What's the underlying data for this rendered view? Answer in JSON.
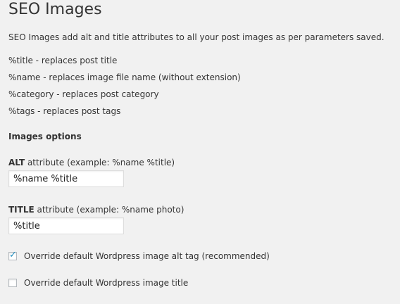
{
  "page": {
    "title": "SEO Images",
    "description": "SEO Images add alt and title attributes to all your post images as per parameters saved."
  },
  "tokens": [
    "%title - replaces post title",
    "%name - replaces image file name (without extension)",
    "%category - replaces post category",
    "%tags - replaces post tags"
  ],
  "options": {
    "heading": "Images options",
    "alt": {
      "label_strong": "ALT",
      "label_rest": " attribute (example: %name %title)",
      "value": "%name %title"
    },
    "title_attr": {
      "label_strong": "TITLE",
      "label_rest": " attribute (example: %name photo)",
      "value": "%title"
    },
    "override_alt": {
      "label": "Override default Wordpress image alt tag (recommended)",
      "checked": true
    },
    "override_title": {
      "label": "Override default Wordpress image title",
      "checked": false
    }
  },
  "colors": {
    "check_mark": "#1e8cbe",
    "background": "#f1f1f1"
  },
  "icons": {
    "checked": "check-mark-icon"
  }
}
